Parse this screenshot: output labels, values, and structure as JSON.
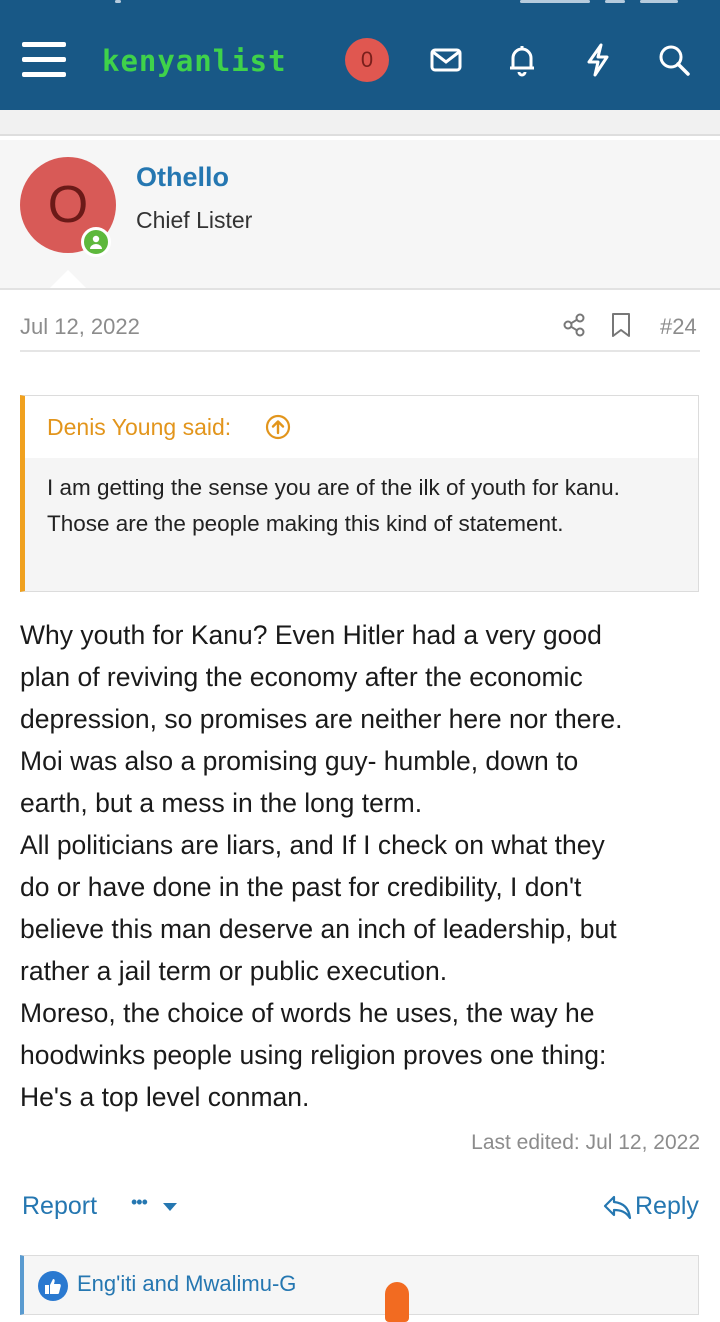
{
  "header": {
    "logo_text": "kenyanlist",
    "notification_count": "0",
    "icons": [
      "menu-icon",
      "envelope-icon",
      "bell-icon",
      "bolt-icon",
      "search-icon"
    ],
    "brand_color": "#185886",
    "logo_color": "#3fd24a"
  },
  "user": {
    "avatar_letter": "O",
    "avatar_color": "#d85a57",
    "name": "Othello",
    "title": "Chief Lister",
    "online": true
  },
  "post": {
    "date": "Jul 12, 2022",
    "number": "#24",
    "quote": {
      "author": "Denis Young said:",
      "text": "I am getting the sense you are of the ilk of youth for kanu. Those are the people making this kind of statement."
    },
    "lines": [
      "Why youth for Kanu? Even Hitler had a very good",
      "plan of reviving the economy after the economic",
      "depression, so promises are neither here nor there.",
      "Moi was also a promising guy- humble, down to",
      "earth, but a mess in the long term.",
      "All politicians are liars, and If I check on what they",
      "do or have done in the past for credibility, I don't",
      "believe this man deserve an inch of leadership, but",
      "rather a jail term or public execution.",
      "Moreso, the choice of words he uses, the way he",
      "hoodwinks people using religion proves one thing:",
      "He's a top level conman."
    ],
    "last_edited": "Last edited: Jul 12, 2022"
  },
  "actions": {
    "report_label": "Report",
    "more_label": "•••",
    "reply_label": "Reply"
  },
  "reactions": {
    "users": "Eng'iti and Mwalimu-G",
    "accent_color": "#2a79d0"
  }
}
